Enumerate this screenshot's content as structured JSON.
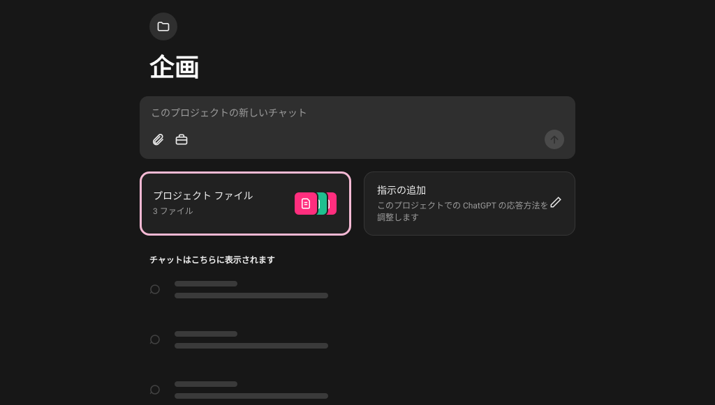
{
  "page": {
    "title": "企画"
  },
  "chat_input": {
    "placeholder": "このプロジェクトの新しいチャット"
  },
  "cards": {
    "files": {
      "title": "プロジェクト ファイル",
      "subtitle": "3 ファイル"
    },
    "instructions": {
      "title": "指示の追加",
      "subtitle": "このプロジェクトでの ChatGPT の応答方法を調整します"
    }
  },
  "helper": {
    "text": "チャットはこちらに表示されます"
  },
  "colors": {
    "pink": "#ff2e7e",
    "green": "#1fbf8f",
    "highlight_border": "#f5b9d4"
  }
}
